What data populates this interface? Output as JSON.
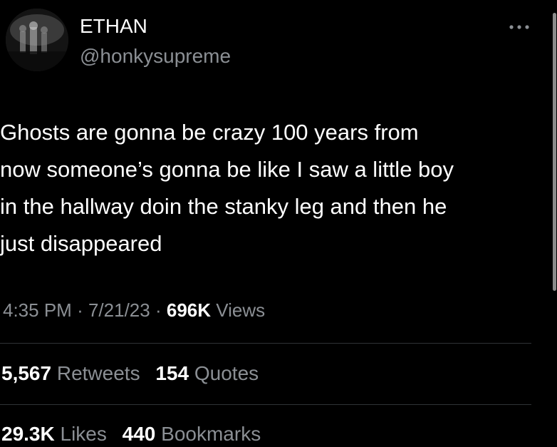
{
  "author": {
    "display_name": "ETHAN",
    "handle": "@honkysupreme",
    "avatar_icon": "profile-photo-grayscale"
  },
  "more_icon": "more-horizontal-icon",
  "tweet": {
    "text": "Ghosts are gonna be crazy 100 years from\nnow someone’s gonna be like I saw a little boy\nin the hallway doin the stanky leg and then he\njust disappeared"
  },
  "meta": {
    "time": "4:35 PM",
    "separator": "·",
    "date": "7/21/23",
    "views_count": "696K",
    "views_label": "Views"
  },
  "stats": {
    "retweets_count": "5,567",
    "retweets_label": "Retweets",
    "quotes_count": "154",
    "quotes_label": "Quotes",
    "likes_count": "29.3K",
    "likes_label": "Likes",
    "bookmarks_count": "440",
    "bookmarks_label": "Bookmarks"
  },
  "colors": {
    "background": "#000000",
    "primary_text": "#ffffff",
    "secondary_text": "#8b8f94",
    "divider": "#2f3336"
  }
}
